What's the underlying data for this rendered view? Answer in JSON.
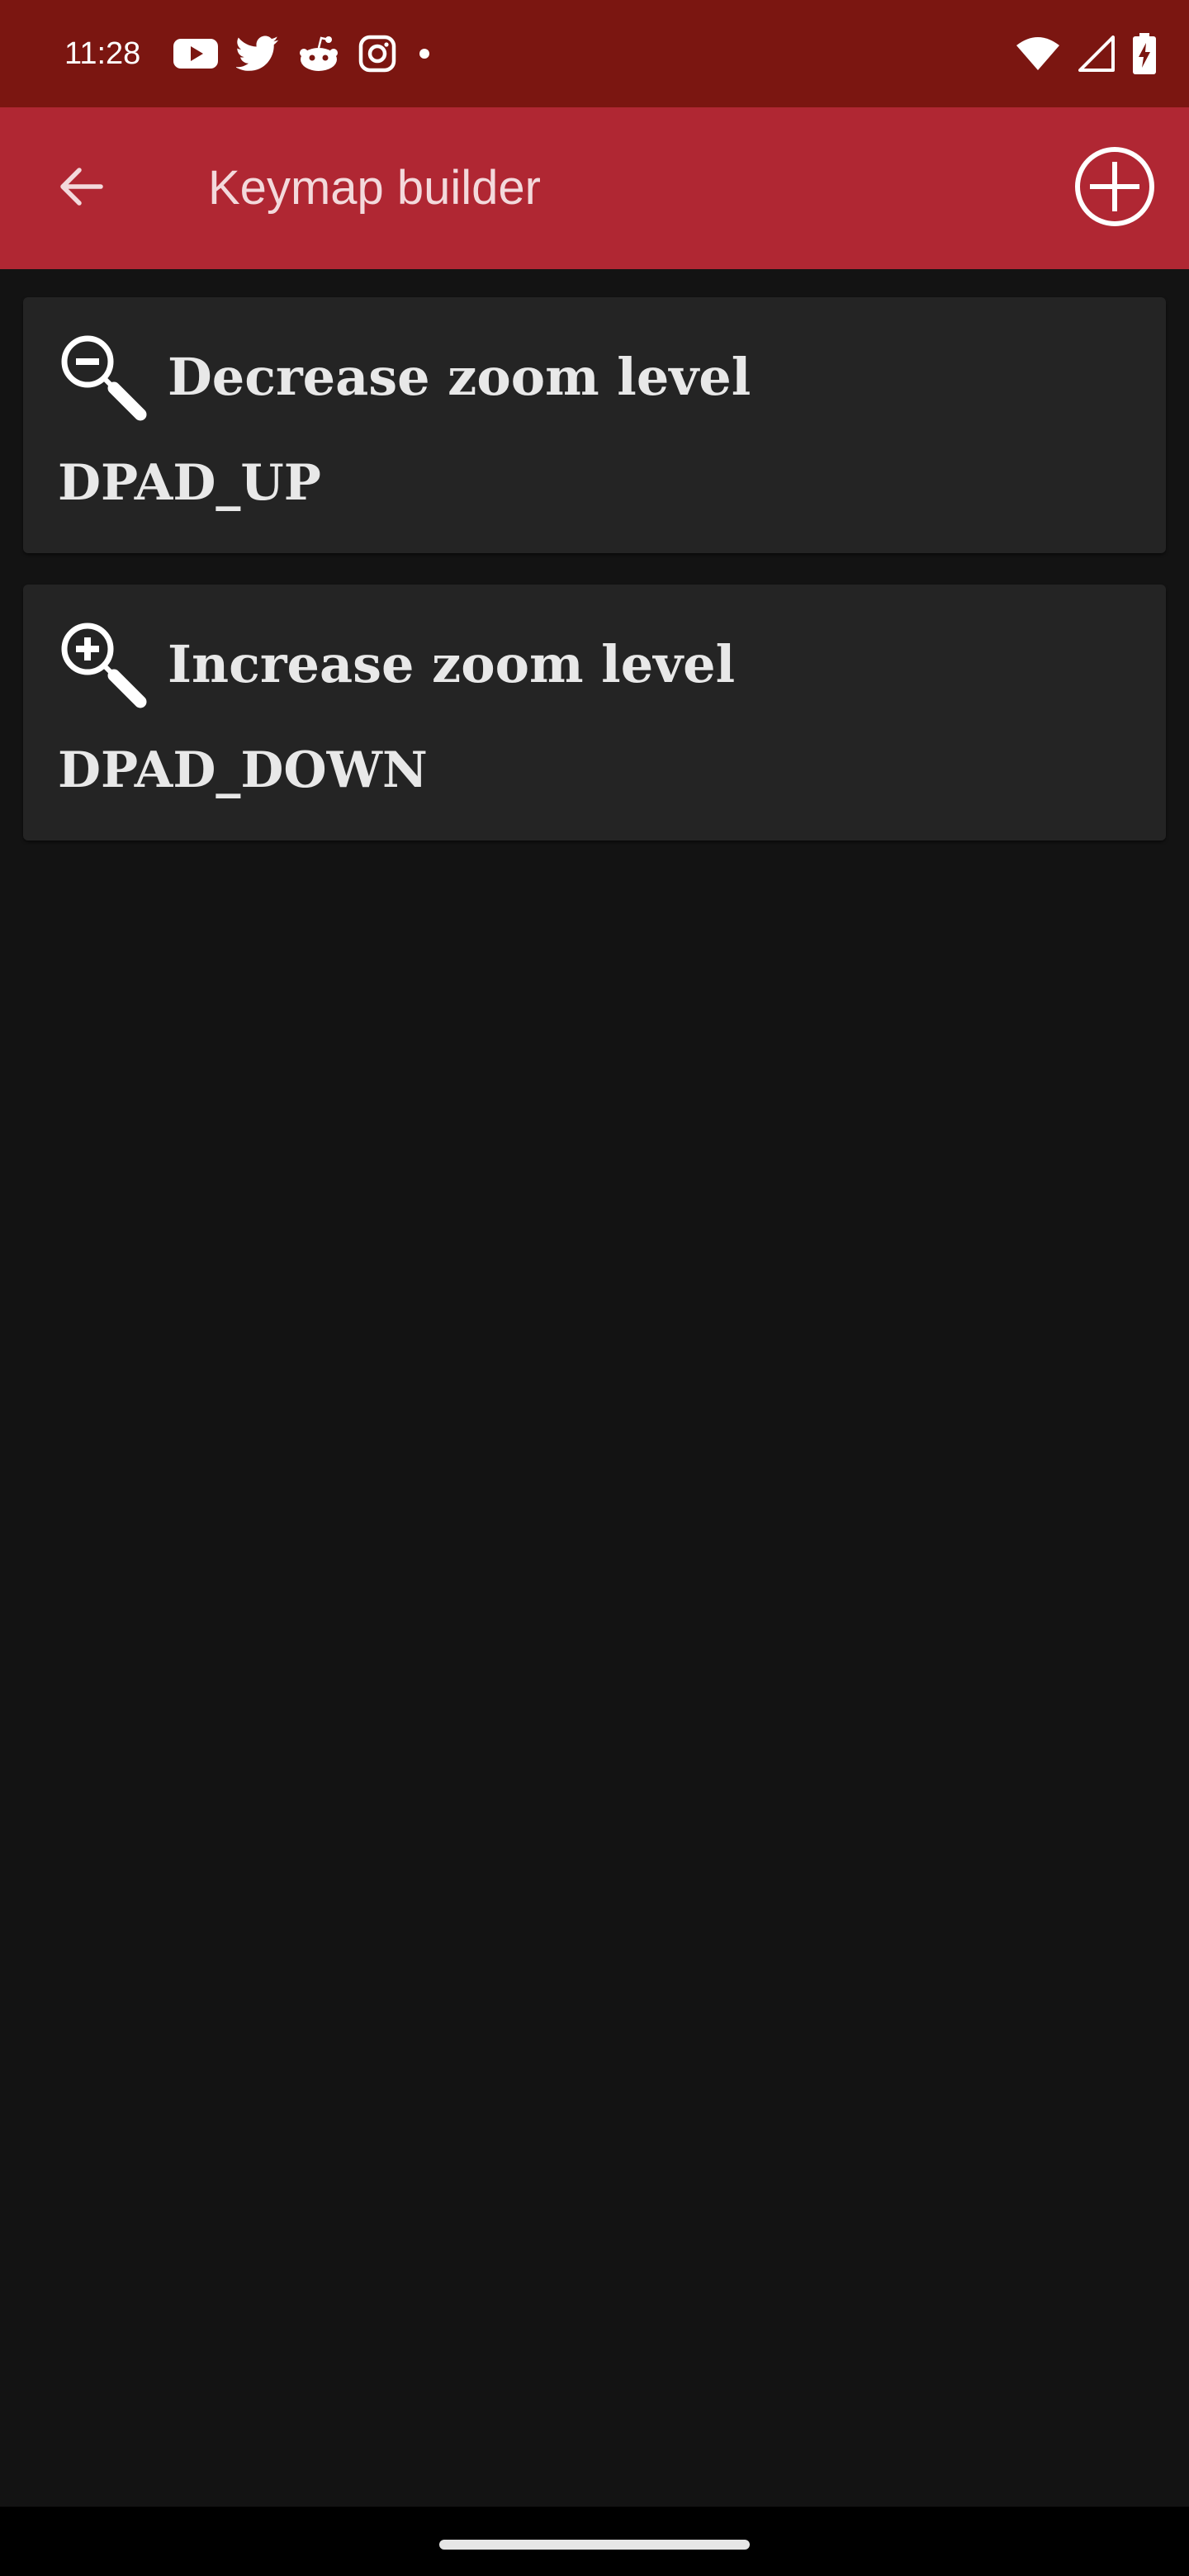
{
  "status_bar": {
    "time": "11:28",
    "notification_icons": [
      "youtube-icon",
      "twitter-icon",
      "reddit-icon",
      "instagram-icon",
      "more-notifications-dot-icon"
    ],
    "system_icons": [
      "wifi-icon",
      "cell-signal-icon",
      "battery-charging-icon"
    ]
  },
  "app_bar": {
    "title": "Keymap builder",
    "back_icon": "arrow-left-icon",
    "add_icon": "add-circle-icon",
    "color": "#b02733"
  },
  "keymaps": [
    {
      "action": "Decrease zoom level",
      "key": "DPAD_UP",
      "icon": "zoom-out-icon"
    },
    {
      "action": "Increase zoom level",
      "key": "DPAD_DOWN",
      "icon": "zoom-in-icon"
    }
  ],
  "colors": {
    "status_bar": "#7b1611",
    "background": "#131313",
    "card": "#242424",
    "text": "#e8e8e8"
  }
}
